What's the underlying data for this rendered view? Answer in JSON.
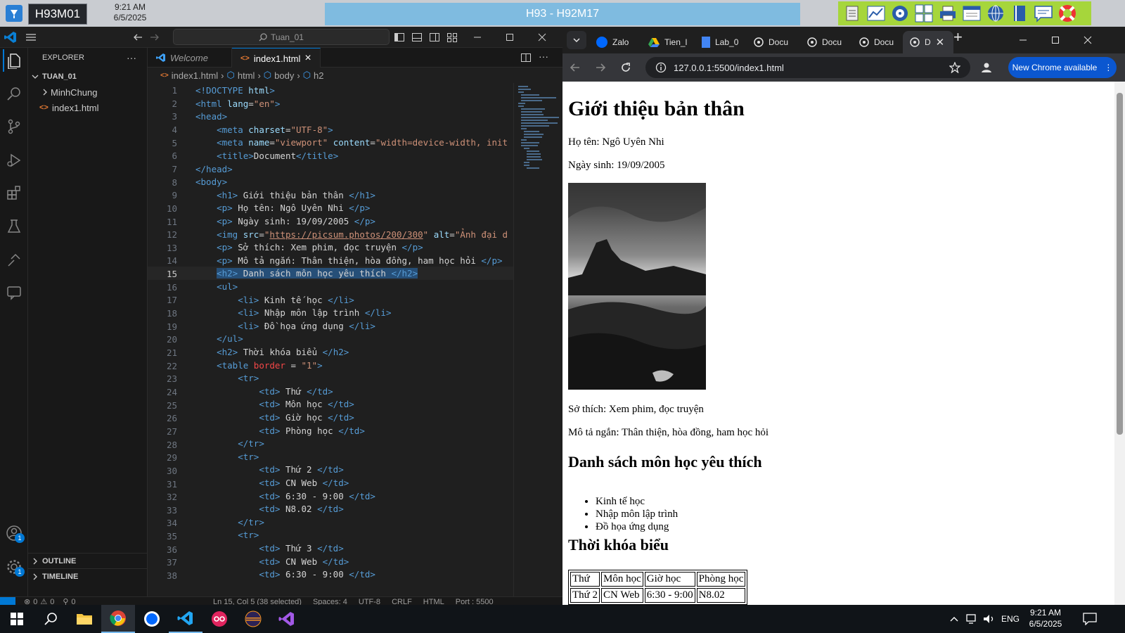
{
  "top_banner": {
    "host_label": "H93M01",
    "time": "9:21 AM",
    "date": "6/5/2025",
    "remote_title": "H93 - H92M17",
    "tools": [
      "document-icon",
      "chart-icon",
      "disc-icon",
      "keyboard-icon",
      "printer-icon",
      "window-icon",
      "globe-icon",
      "book-icon",
      "chat-icon",
      "lifebuoy-icon"
    ]
  },
  "vscode": {
    "search_text": "Tuan_01",
    "activity": [
      {
        "name": "explorer-icon"
      },
      {
        "name": "search-icon"
      },
      {
        "name": "source-control-icon"
      },
      {
        "name": "run-debug-icon"
      },
      {
        "name": "extensions-icon"
      },
      {
        "name": "testing-icon"
      },
      {
        "name": "remote-icon"
      },
      {
        "name": "chat-icon"
      }
    ],
    "account_badge": "1",
    "settings_badge": "1",
    "explorer": {
      "title": "EXPLORER",
      "more": "···",
      "folder": "TUAN_01",
      "items": [
        {
          "label": "MinhChung",
          "type": "folder"
        },
        {
          "label": "index1.html",
          "type": "file"
        }
      ],
      "outline": "OUTLINE",
      "timeline": "TIMELINE"
    },
    "tabs": [
      {
        "label": "Welcome",
        "active": false
      },
      {
        "label": "index1.html",
        "active": true
      }
    ],
    "tab_close": "×",
    "breadcrumb": [
      "index1.html",
      "html",
      "body",
      "h2"
    ],
    "line_numbers": [
      "1",
      "2",
      "3",
      "4",
      "5",
      "6",
      "7",
      "8",
      "9",
      "10",
      "11",
      "12",
      "13",
      "14",
      "15",
      "16",
      "17",
      "18",
      "19",
      "20",
      "21",
      "22",
      "23",
      "24",
      "25",
      "26",
      "27",
      "28",
      "29",
      "30",
      "31",
      "32",
      "33",
      "34",
      "35",
      "36",
      "37",
      "38"
    ],
    "active_line": "15",
    "status": {
      "errors": "0",
      "warnings": "0",
      "ports": "0",
      "cursor": "Ln 15, Col 5 (38 selected)",
      "spaces": "Spaces: 4",
      "encoding": "UTF-8",
      "eol": "CRLF",
      "language": "HTML",
      "port": "Port : 5500"
    }
  },
  "chrome": {
    "tabs": [
      "Zalo",
      "Tien_l",
      "Lab_0",
      "Docu",
      "Docu",
      "Docu",
      "D"
    ],
    "new_tab": "+",
    "url": "127.0.0.1:5500/index1.html",
    "new_chrome_label": "New Chrome available",
    "page": {
      "h1": "Giới thiệu bản thân",
      "name": "Họ tên: Ngô Uyên Nhi",
      "dob": "Ngày sinh: 19/09/2005",
      "hobby": "Sở thích: Xem phim, đọc truyện",
      "desc": "Mô tả ngắn: Thân thiện, hòa đồng, ham học hỏi",
      "h2_subjects": "Danh sách môn học yêu thích",
      "subjects": [
        "Kinh tế học",
        "Nhập môn lập trình",
        "Đồ họa ứng dụng"
      ],
      "h2_schedule": "Thời khóa biểu",
      "table_header": [
        "Thứ",
        "Môn học",
        "Giờ học",
        "Phòng học"
      ],
      "table_row": [
        "Thứ 2",
        "CN Web",
        "6:30 - 9:00",
        "N8.02"
      ]
    }
  },
  "taskbar": {
    "apps": [
      "windows-start-icon",
      "search-icon",
      "file-explorer-icon",
      "chrome-icon",
      "zalo-icon",
      "vscode-icon",
      "app-icon",
      "eclipse-icon",
      "visual-studio-icon"
    ],
    "lang": "ENG",
    "time": "9:21 AM",
    "date": "6/5/2025"
  },
  "colors": {
    "accent": "#0078d4",
    "remote_bar": "#7fbbe0",
    "tools_bar": "#a6d63b",
    "editor_bg": "#1f1f1f"
  }
}
